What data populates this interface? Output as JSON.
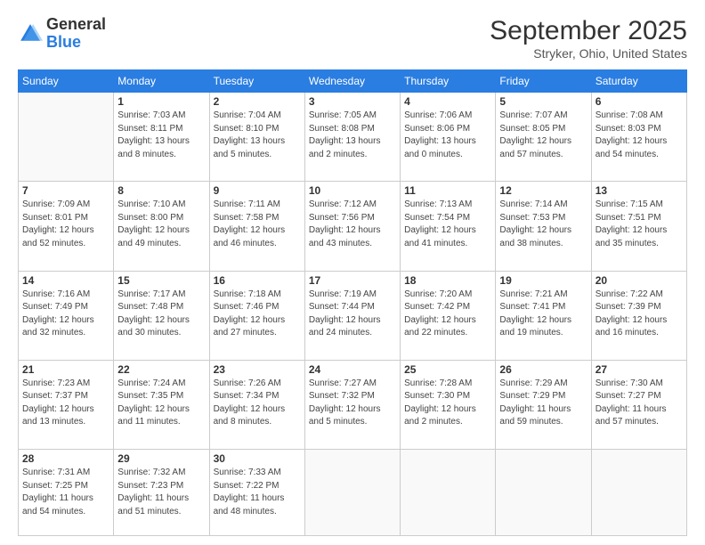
{
  "header": {
    "logo_general": "General",
    "logo_blue": "Blue",
    "month": "September 2025",
    "location": "Stryker, Ohio, United States"
  },
  "weekdays": [
    "Sunday",
    "Monday",
    "Tuesday",
    "Wednesday",
    "Thursday",
    "Friday",
    "Saturday"
  ],
  "weeks": [
    [
      {
        "day": "",
        "info": ""
      },
      {
        "day": "1",
        "info": "Sunrise: 7:03 AM\nSunset: 8:11 PM\nDaylight: 13 hours\nand 8 minutes."
      },
      {
        "day": "2",
        "info": "Sunrise: 7:04 AM\nSunset: 8:10 PM\nDaylight: 13 hours\nand 5 minutes."
      },
      {
        "day": "3",
        "info": "Sunrise: 7:05 AM\nSunset: 8:08 PM\nDaylight: 13 hours\nand 2 minutes."
      },
      {
        "day": "4",
        "info": "Sunrise: 7:06 AM\nSunset: 8:06 PM\nDaylight: 13 hours\nand 0 minutes."
      },
      {
        "day": "5",
        "info": "Sunrise: 7:07 AM\nSunset: 8:05 PM\nDaylight: 12 hours\nand 57 minutes."
      },
      {
        "day": "6",
        "info": "Sunrise: 7:08 AM\nSunset: 8:03 PM\nDaylight: 12 hours\nand 54 minutes."
      }
    ],
    [
      {
        "day": "7",
        "info": "Sunrise: 7:09 AM\nSunset: 8:01 PM\nDaylight: 12 hours\nand 52 minutes."
      },
      {
        "day": "8",
        "info": "Sunrise: 7:10 AM\nSunset: 8:00 PM\nDaylight: 12 hours\nand 49 minutes."
      },
      {
        "day": "9",
        "info": "Sunrise: 7:11 AM\nSunset: 7:58 PM\nDaylight: 12 hours\nand 46 minutes."
      },
      {
        "day": "10",
        "info": "Sunrise: 7:12 AM\nSunset: 7:56 PM\nDaylight: 12 hours\nand 43 minutes."
      },
      {
        "day": "11",
        "info": "Sunrise: 7:13 AM\nSunset: 7:54 PM\nDaylight: 12 hours\nand 41 minutes."
      },
      {
        "day": "12",
        "info": "Sunrise: 7:14 AM\nSunset: 7:53 PM\nDaylight: 12 hours\nand 38 minutes."
      },
      {
        "day": "13",
        "info": "Sunrise: 7:15 AM\nSunset: 7:51 PM\nDaylight: 12 hours\nand 35 minutes."
      }
    ],
    [
      {
        "day": "14",
        "info": "Sunrise: 7:16 AM\nSunset: 7:49 PM\nDaylight: 12 hours\nand 32 minutes."
      },
      {
        "day": "15",
        "info": "Sunrise: 7:17 AM\nSunset: 7:48 PM\nDaylight: 12 hours\nand 30 minutes."
      },
      {
        "day": "16",
        "info": "Sunrise: 7:18 AM\nSunset: 7:46 PM\nDaylight: 12 hours\nand 27 minutes."
      },
      {
        "day": "17",
        "info": "Sunrise: 7:19 AM\nSunset: 7:44 PM\nDaylight: 12 hours\nand 24 minutes."
      },
      {
        "day": "18",
        "info": "Sunrise: 7:20 AM\nSunset: 7:42 PM\nDaylight: 12 hours\nand 22 minutes."
      },
      {
        "day": "19",
        "info": "Sunrise: 7:21 AM\nSunset: 7:41 PM\nDaylight: 12 hours\nand 19 minutes."
      },
      {
        "day": "20",
        "info": "Sunrise: 7:22 AM\nSunset: 7:39 PM\nDaylight: 12 hours\nand 16 minutes."
      }
    ],
    [
      {
        "day": "21",
        "info": "Sunrise: 7:23 AM\nSunset: 7:37 PM\nDaylight: 12 hours\nand 13 minutes."
      },
      {
        "day": "22",
        "info": "Sunrise: 7:24 AM\nSunset: 7:35 PM\nDaylight: 12 hours\nand 11 minutes."
      },
      {
        "day": "23",
        "info": "Sunrise: 7:26 AM\nSunset: 7:34 PM\nDaylight: 12 hours\nand 8 minutes."
      },
      {
        "day": "24",
        "info": "Sunrise: 7:27 AM\nSunset: 7:32 PM\nDaylight: 12 hours\nand 5 minutes."
      },
      {
        "day": "25",
        "info": "Sunrise: 7:28 AM\nSunset: 7:30 PM\nDaylight: 12 hours\nand 2 minutes."
      },
      {
        "day": "26",
        "info": "Sunrise: 7:29 AM\nSunset: 7:29 PM\nDaylight: 11 hours\nand 59 minutes."
      },
      {
        "day": "27",
        "info": "Sunrise: 7:30 AM\nSunset: 7:27 PM\nDaylight: 11 hours\nand 57 minutes."
      }
    ],
    [
      {
        "day": "28",
        "info": "Sunrise: 7:31 AM\nSunset: 7:25 PM\nDaylight: 11 hours\nand 54 minutes."
      },
      {
        "day": "29",
        "info": "Sunrise: 7:32 AM\nSunset: 7:23 PM\nDaylight: 11 hours\nand 51 minutes."
      },
      {
        "day": "30",
        "info": "Sunrise: 7:33 AM\nSunset: 7:22 PM\nDaylight: 11 hours\nand 48 minutes."
      },
      {
        "day": "",
        "info": ""
      },
      {
        "day": "",
        "info": ""
      },
      {
        "day": "",
        "info": ""
      },
      {
        "day": "",
        "info": ""
      }
    ]
  ]
}
